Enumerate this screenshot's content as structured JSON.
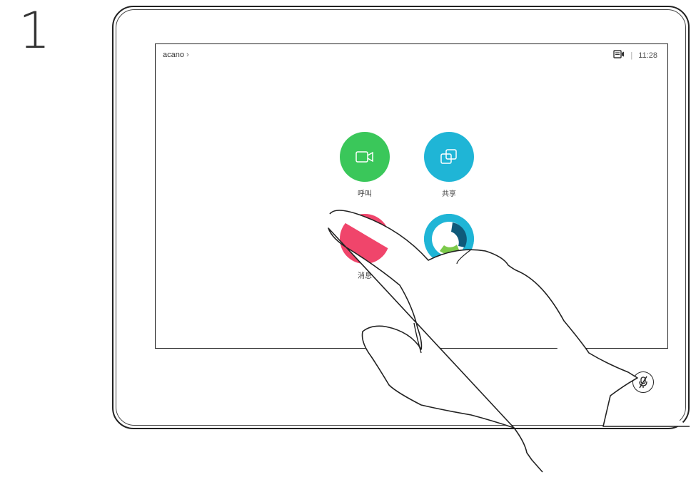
{
  "step": {
    "number": "1"
  },
  "header": {
    "breadcrumb": "acano",
    "breadcrumb_chevron": "›",
    "separator": "|",
    "time": "11:28",
    "status_icon": "self-view-icon"
  },
  "tiles": [
    {
      "label": "呼叫",
      "icon": "video-camera-icon",
      "color": "#3ac75a"
    },
    {
      "label": "共享",
      "icon": "share-screen-icon",
      "color": "#1fb5d6"
    },
    {
      "label": "消息",
      "icon": "message-icon",
      "color": "#f0456b"
    },
    {
      "label": "",
      "icon": "webex-logo-icon",
      "color": "#1fb5d6"
    }
  ],
  "controls": {
    "mute_icon": "microphone-muted-icon"
  },
  "colors": {
    "frame": "#222222",
    "screen_bg": "#ffffff"
  }
}
